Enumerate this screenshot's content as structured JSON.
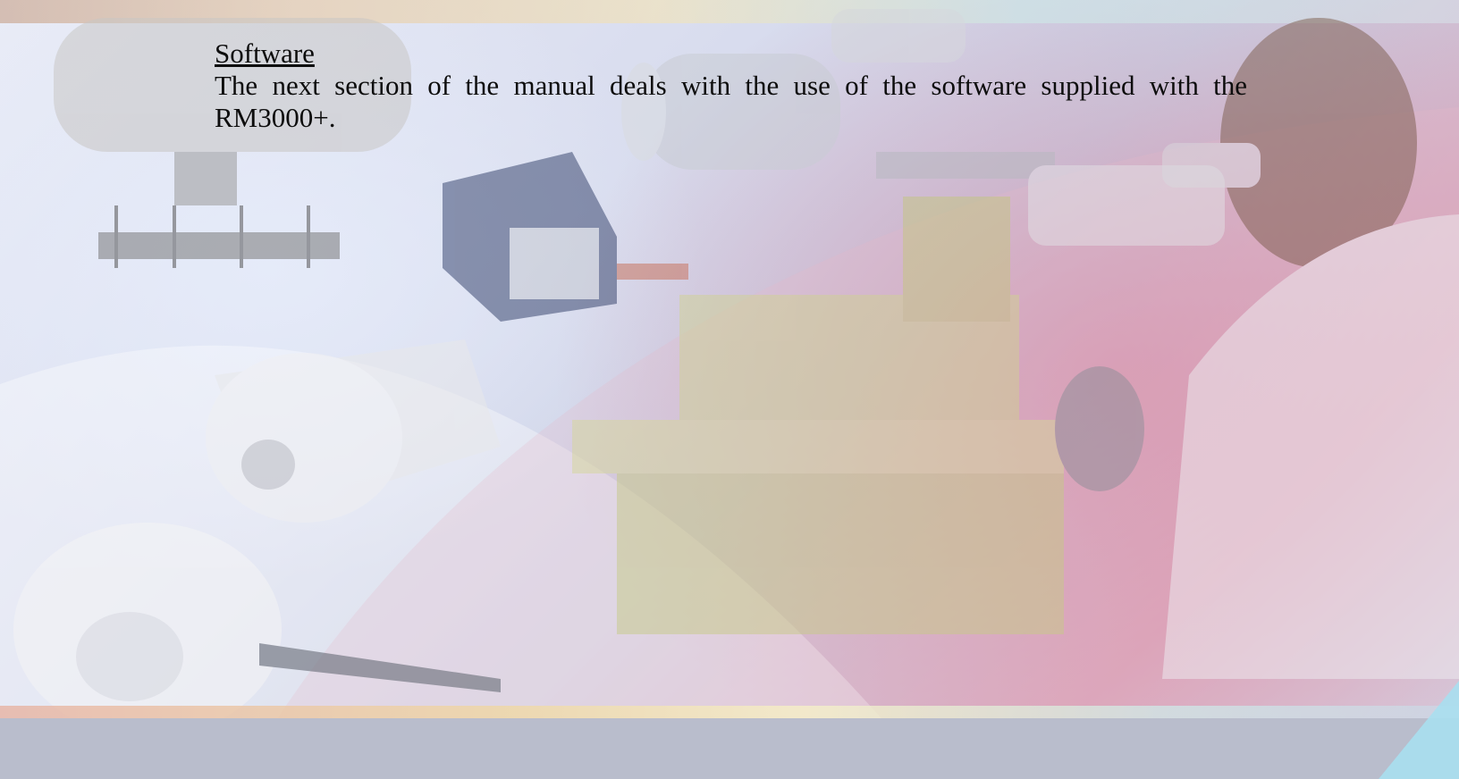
{
  "document": {
    "heading": "Software",
    "body": "The next section of the manual deals with the use of the software supplied with the RM3000+."
  },
  "colors": {
    "text": "#0d0d0d",
    "background_tint": "#d8dcee",
    "pink_tint": "#d9a8bd",
    "corner_accent": "#a9dff0"
  }
}
